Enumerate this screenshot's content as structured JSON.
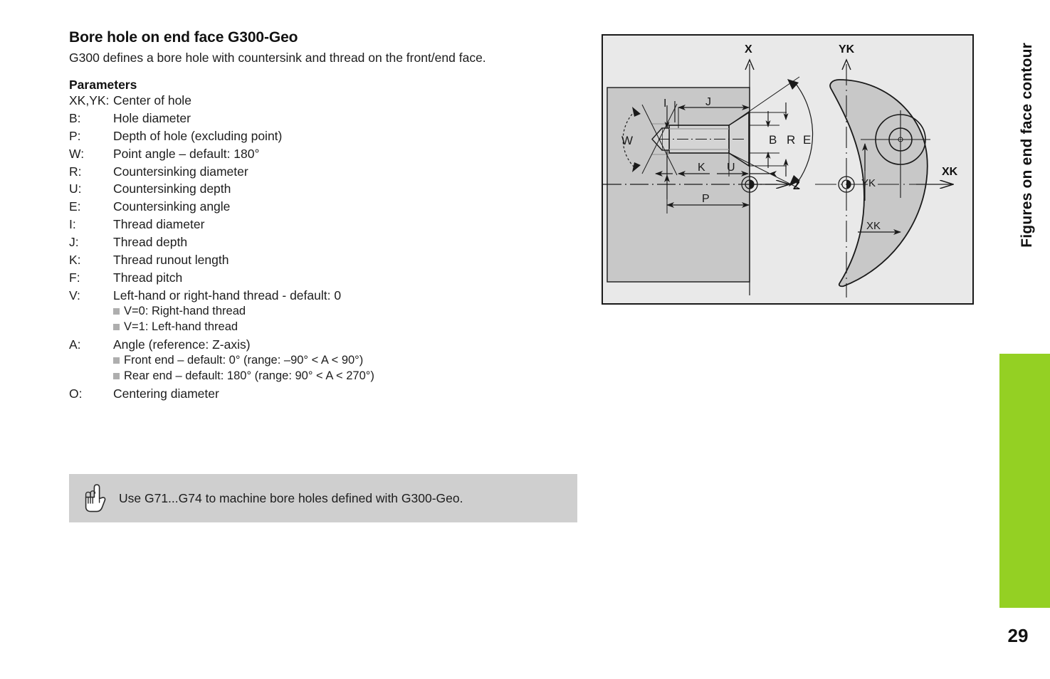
{
  "document": {
    "title": "Bore hole on end face G300-Geo",
    "intro": "G300 defines a bore hole with countersink and thread on the front/end face.",
    "parameters_heading": "Parameters",
    "page_number": "29",
    "side_label": "Figures on end face contour",
    "accent_color": "#94d023"
  },
  "parameters": [
    {
      "key": "XK,YK:",
      "value": "Center of hole",
      "compact": true
    },
    {
      "key": "B:",
      "value": "Hole diameter"
    },
    {
      "key": "P:",
      "value": "Depth of hole (excluding point)"
    },
    {
      "key": "W:",
      "value": "Point angle – default: 180°"
    },
    {
      "key": "R:",
      "value": "Countersinking diameter"
    },
    {
      "key": "U:",
      "value": "Countersinking depth"
    },
    {
      "key": "E:",
      "value": "Countersinking angle"
    },
    {
      "key": "I:",
      "value": "Thread diameter"
    },
    {
      "key": "J:",
      "value": "Thread depth"
    },
    {
      "key": "K:",
      "value": "Thread runout length"
    },
    {
      "key": "F:",
      "value": "Thread pitch"
    },
    {
      "key": "V:",
      "value": "Left-hand or right-hand thread - default: 0",
      "subitems": [
        "V=0: Right-hand thread",
        "V=1: Left-hand thread"
      ]
    },
    {
      "key": "A:",
      "value": "Angle (reference: Z-axis)",
      "subitems": [
        "Front end – default: 0° (range: –90° < A < 90°)",
        "Rear end – default: 180° (range: 90° < A < 270°)"
      ]
    },
    {
      "key": "O:",
      "value": "Centering diameter"
    }
  ],
  "note": {
    "icon": "pointing-hand-icon",
    "text": "Use G71...G74 to machine bore holes defined with G300-Geo."
  },
  "figure": {
    "background_color": "#e9e9e9",
    "part_fill": "#c8c8c8",
    "line_color": "#1a1a1a",
    "axis_labels": {
      "x_axis": "X",
      "z_axis": "Z",
      "yk_axis": "YK",
      "xk_axis": "XK"
    },
    "section_view_dimensions": {
      "point_angle": "W",
      "thread_diameter": "I",
      "thread_depth": "J",
      "hole_diameter": "B",
      "countersink_diameter": "R",
      "countersink_angle": "E",
      "thread_runout": "K",
      "countersink_depth": "U",
      "hole_depth": "P"
    },
    "face_view_dimensions": {
      "yk_offset": "YK",
      "xk_offset": "XK"
    }
  }
}
